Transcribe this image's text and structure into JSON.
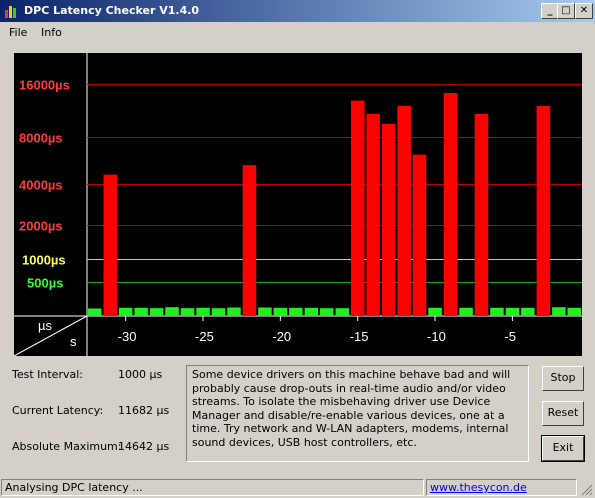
{
  "window": {
    "title": "DPC Latency Checker V1.4.0",
    "controls": {
      "minimize": "_",
      "maximize": "□",
      "close": "✕"
    }
  },
  "menu": [
    "File",
    "Info"
  ],
  "chart_data": {
    "type": "bar",
    "y_labels": [
      {
        "text": "16000µs",
        "color": "#ff3b3b",
        "value": 16000
      },
      {
        "text": "8000µs",
        "color": "#ff3b3b",
        "value": 8000
      },
      {
        "text": "4000µs",
        "color": "#ff3b3b",
        "value": 4000
      },
      {
        "text": "2000µs",
        "color": "#ff3b3b",
        "value": 2000
      },
      {
        "text": "1000µs",
        "color": "#ffff55",
        "value": 1000
      },
      {
        "text": "500µs",
        "color": "#33ff33",
        "value": 500
      }
    ],
    "x_ticks": [
      "-30",
      "-25",
      "-20",
      "-15",
      "-10",
      "-5"
    ],
    "corner_labels": {
      "y_unit": "µs",
      "x_unit": "s"
    },
    "x": [
      -32,
      -31,
      -30,
      -29,
      -28,
      -27,
      -26,
      -25,
      -24,
      -23,
      -22,
      -21,
      -20,
      -19,
      -18,
      -17,
      -16,
      -15,
      -14,
      -13,
      -12,
      -11,
      -10,
      -9,
      -8,
      -7,
      -6,
      -5,
      -4,
      -3,
      -2,
      -1
    ],
    "values": [
      110,
      4800,
      120,
      120,
      115,
      130,
      115,
      120,
      115,
      125,
      5600,
      125,
      120,
      120,
      120,
      115,
      115,
      13500,
      11500,
      10000,
      12700,
      6500,
      120,
      14642,
      120,
      11500,
      120,
      120,
      120,
      12700,
      130,
      120
    ],
    "colors": {
      "high": "#ff0000",
      "low": "#22ee22",
      "grid_red": "#c00000",
      "grid_yellow": "#e0e000",
      "grid_green": "#00b000"
    }
  },
  "stats": {
    "test_interval": {
      "label": "Test Interval:",
      "value": "1000 µs"
    },
    "current_latency": {
      "label": "Current Latency:",
      "value": "11682 µs"
    },
    "absolute_maximum": {
      "label": "Absolute Maximum:",
      "value": "14642 µs"
    }
  },
  "info_text": "Some device drivers on this machine behave bad and will probably cause drop-outs in real-time audio and/or video streams. To isolate the misbehaving driver use Device Manager and disable/re-enable various devices, one at a time. Try network and W-LAN adapters, modems, internal sound devices, USB host controllers, etc.",
  "buttons": {
    "stop": "Stop",
    "reset": "Reset",
    "exit": "Exit"
  },
  "status": {
    "message": "Analysing DPC latency ...",
    "link": "www.thesycon.de"
  }
}
